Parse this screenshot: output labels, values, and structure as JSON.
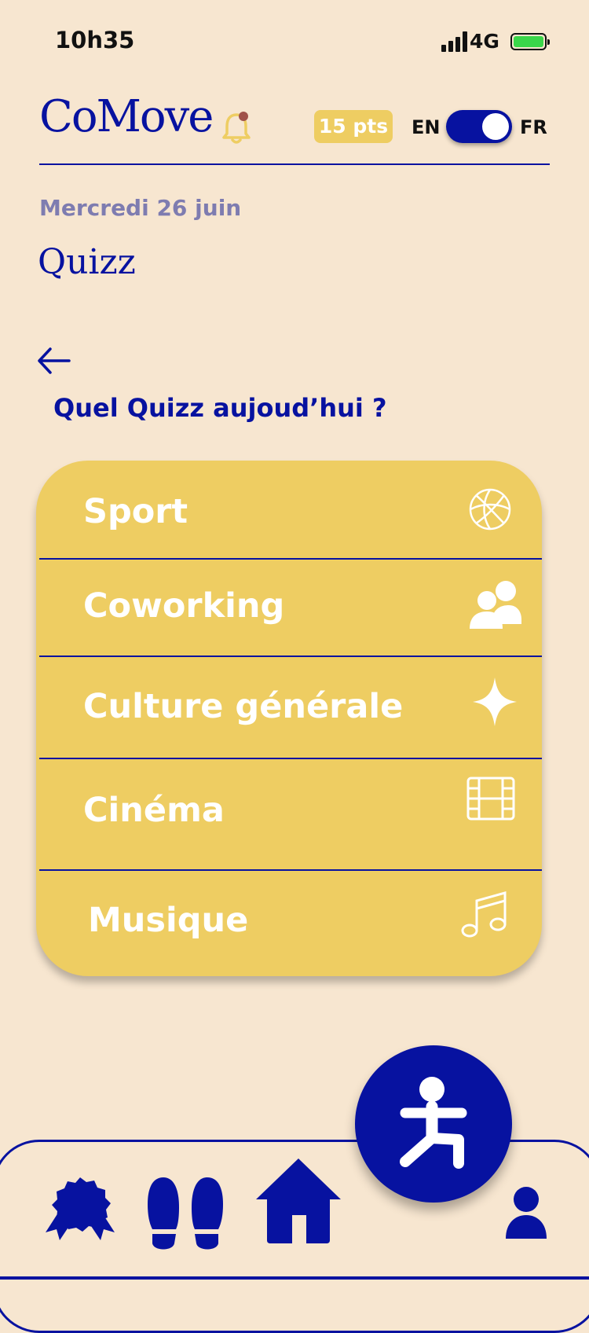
{
  "status_bar": {
    "time": "10h35",
    "network": "4G"
  },
  "header": {
    "logo": "CoMove",
    "points": "15 pts",
    "lang_left": "EN",
    "lang_right": "FR",
    "toggle_state": "FR"
  },
  "page": {
    "date": "Mercredi 26 juin",
    "title": "Quizz",
    "question": "Quel Quizz aujoud’hui ?"
  },
  "quiz_categories": [
    {
      "label": "Sport",
      "icon": "basketball-icon"
    },
    {
      "label": "Coworking",
      "icon": "users-icon"
    },
    {
      "label": "Culture générale",
      "icon": "sparkle-icon"
    },
    {
      "label": "Cinéma",
      "icon": "film-icon"
    },
    {
      "label": "Musique",
      "icon": "music-note-icon"
    }
  ],
  "bottom_nav": [
    {
      "icon": "award-badge-icon"
    },
    {
      "icon": "footprints-icon"
    },
    {
      "icon": "home-icon"
    },
    {
      "icon": "exercise-person-icon"
    },
    {
      "icon": "profile-icon"
    }
  ],
  "colors": {
    "background": "#f7e6d0",
    "primary": "#0712a0",
    "accent": "#eecd62",
    "battery": "#3ad64a"
  }
}
